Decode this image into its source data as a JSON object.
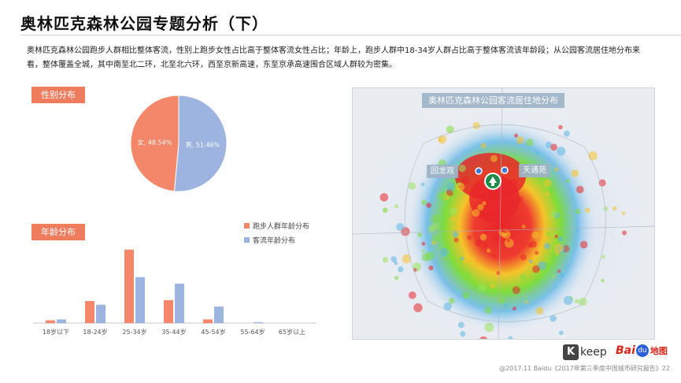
{
  "page": {
    "title": "奥林匹克森林公园专题分析（下）",
    "summary": "奥林匹克森林公园跑步人群相比整体客流，性别上跑步女性占比高于整体客流女性占比；年龄上，跑步人群中18-34岁人群占比高于整体客流该年龄段；从公园客流居住地分布来看，整体覆盖全城，其中南至北二环，北至北六环，西至京新高速，东至京承高速围合区域人群较为密集。"
  },
  "sections": {
    "gender_tag": "性别分布",
    "age_tag": "年龄分布"
  },
  "legend": {
    "runner": "跑步人群年龄分布",
    "visitor": "客流年龄分布"
  },
  "colors": {
    "runner": "#f4866a",
    "visitor": "#9db4e0",
    "tag": "#f07c5e"
  },
  "map": {
    "title": "奥林匹克森林公园客流居住地分布",
    "label_left": "回龙观",
    "label_right": "天通苑"
  },
  "logos": {
    "keep_k": "K",
    "keep_text": "keep",
    "baidu_bai": "Bai",
    "baidu_du": "du",
    "baidu_map": "地图"
  },
  "footer": {
    "text": "@2017.11 Baidu《2017年第三季度中国城市研究报告》22"
  },
  "chart_data": [
    {
      "type": "pie",
      "slices": [
        {
          "label": "女",
          "value": 48.54,
          "display": "女, 48.54%",
          "color": "#f4866a"
        },
        {
          "label": "男",
          "value": 51.46,
          "display": "男, 51.46%",
          "color": "#9db4e0"
        }
      ]
    },
    {
      "type": "bar",
      "categories": [
        "18岁以下",
        "18-24岁",
        "25-34岁",
        "35-44岁",
        "45-54岁",
        "55-64岁",
        "65岁以上"
      ],
      "series": [
        {
          "name": "跑步人群年龄分布",
          "values": [
            1.5,
            12,
            40,
            12.5,
            2,
            0,
            0
          ]
        },
        {
          "name": "客流年龄分布",
          "values": [
            2,
            10,
            25,
            21.5,
            9,
            0.5,
            0
          ]
        }
      ],
      "ylim": [
        0,
        42
      ],
      "grid": false
    }
  ]
}
